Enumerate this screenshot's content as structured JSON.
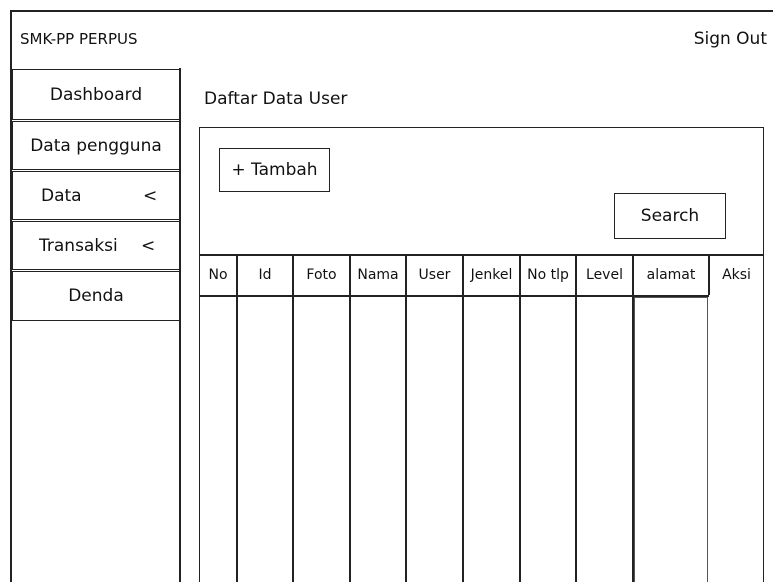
{
  "header": {
    "brand": "SMK-PP PERPUS",
    "signout_label": "Sign Out"
  },
  "sidebar": {
    "items": [
      {
        "label": "Dashboard",
        "chevron": ""
      },
      {
        "label": "Data pengguna",
        "chevron": ""
      },
      {
        "label": "Data",
        "chevron": "<"
      },
      {
        "label": "Transaksi",
        "chevron": "<"
      },
      {
        "label": "Denda",
        "chevron": ""
      }
    ]
  },
  "main": {
    "title": "Daftar Data User",
    "add_button": "+ Tambah",
    "search_button": "Search",
    "table": {
      "columns": [
        "No",
        "Id",
        "Foto",
        "Nama",
        "User",
        "Jenkel",
        "No tlp",
        "Level",
        "alamat",
        "Aksi"
      ],
      "rows": []
    }
  }
}
